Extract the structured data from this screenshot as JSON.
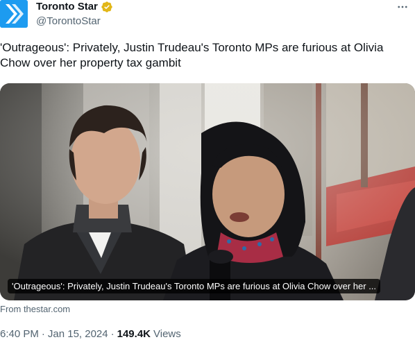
{
  "author": {
    "display_name": "Toronto Star",
    "handle": "@TorontoStar",
    "avatar_icon": "toronto-star-logo",
    "verified_icon": "verified-badge-icon",
    "verified_color": "#e2b719",
    "brand_color": "#1d9bf0"
  },
  "menu": {
    "more_icon": "more-options-icon"
  },
  "tweet": {
    "text": "'Outrageous': Privately, Justin Trudeau's Toronto MPs are furious at Olivia Chow over her property tax gambit"
  },
  "card": {
    "caption": "'Outrageous': Privately, Justin Trudeau's Toronto MPs are furious at Olivia Chow over her ...",
    "source": "From thestar.com"
  },
  "meta": {
    "time": "6:40 PM",
    "separator": "·",
    "date": "Jan 15, 2024",
    "views_count": "149.4K",
    "views_label": "Views"
  }
}
